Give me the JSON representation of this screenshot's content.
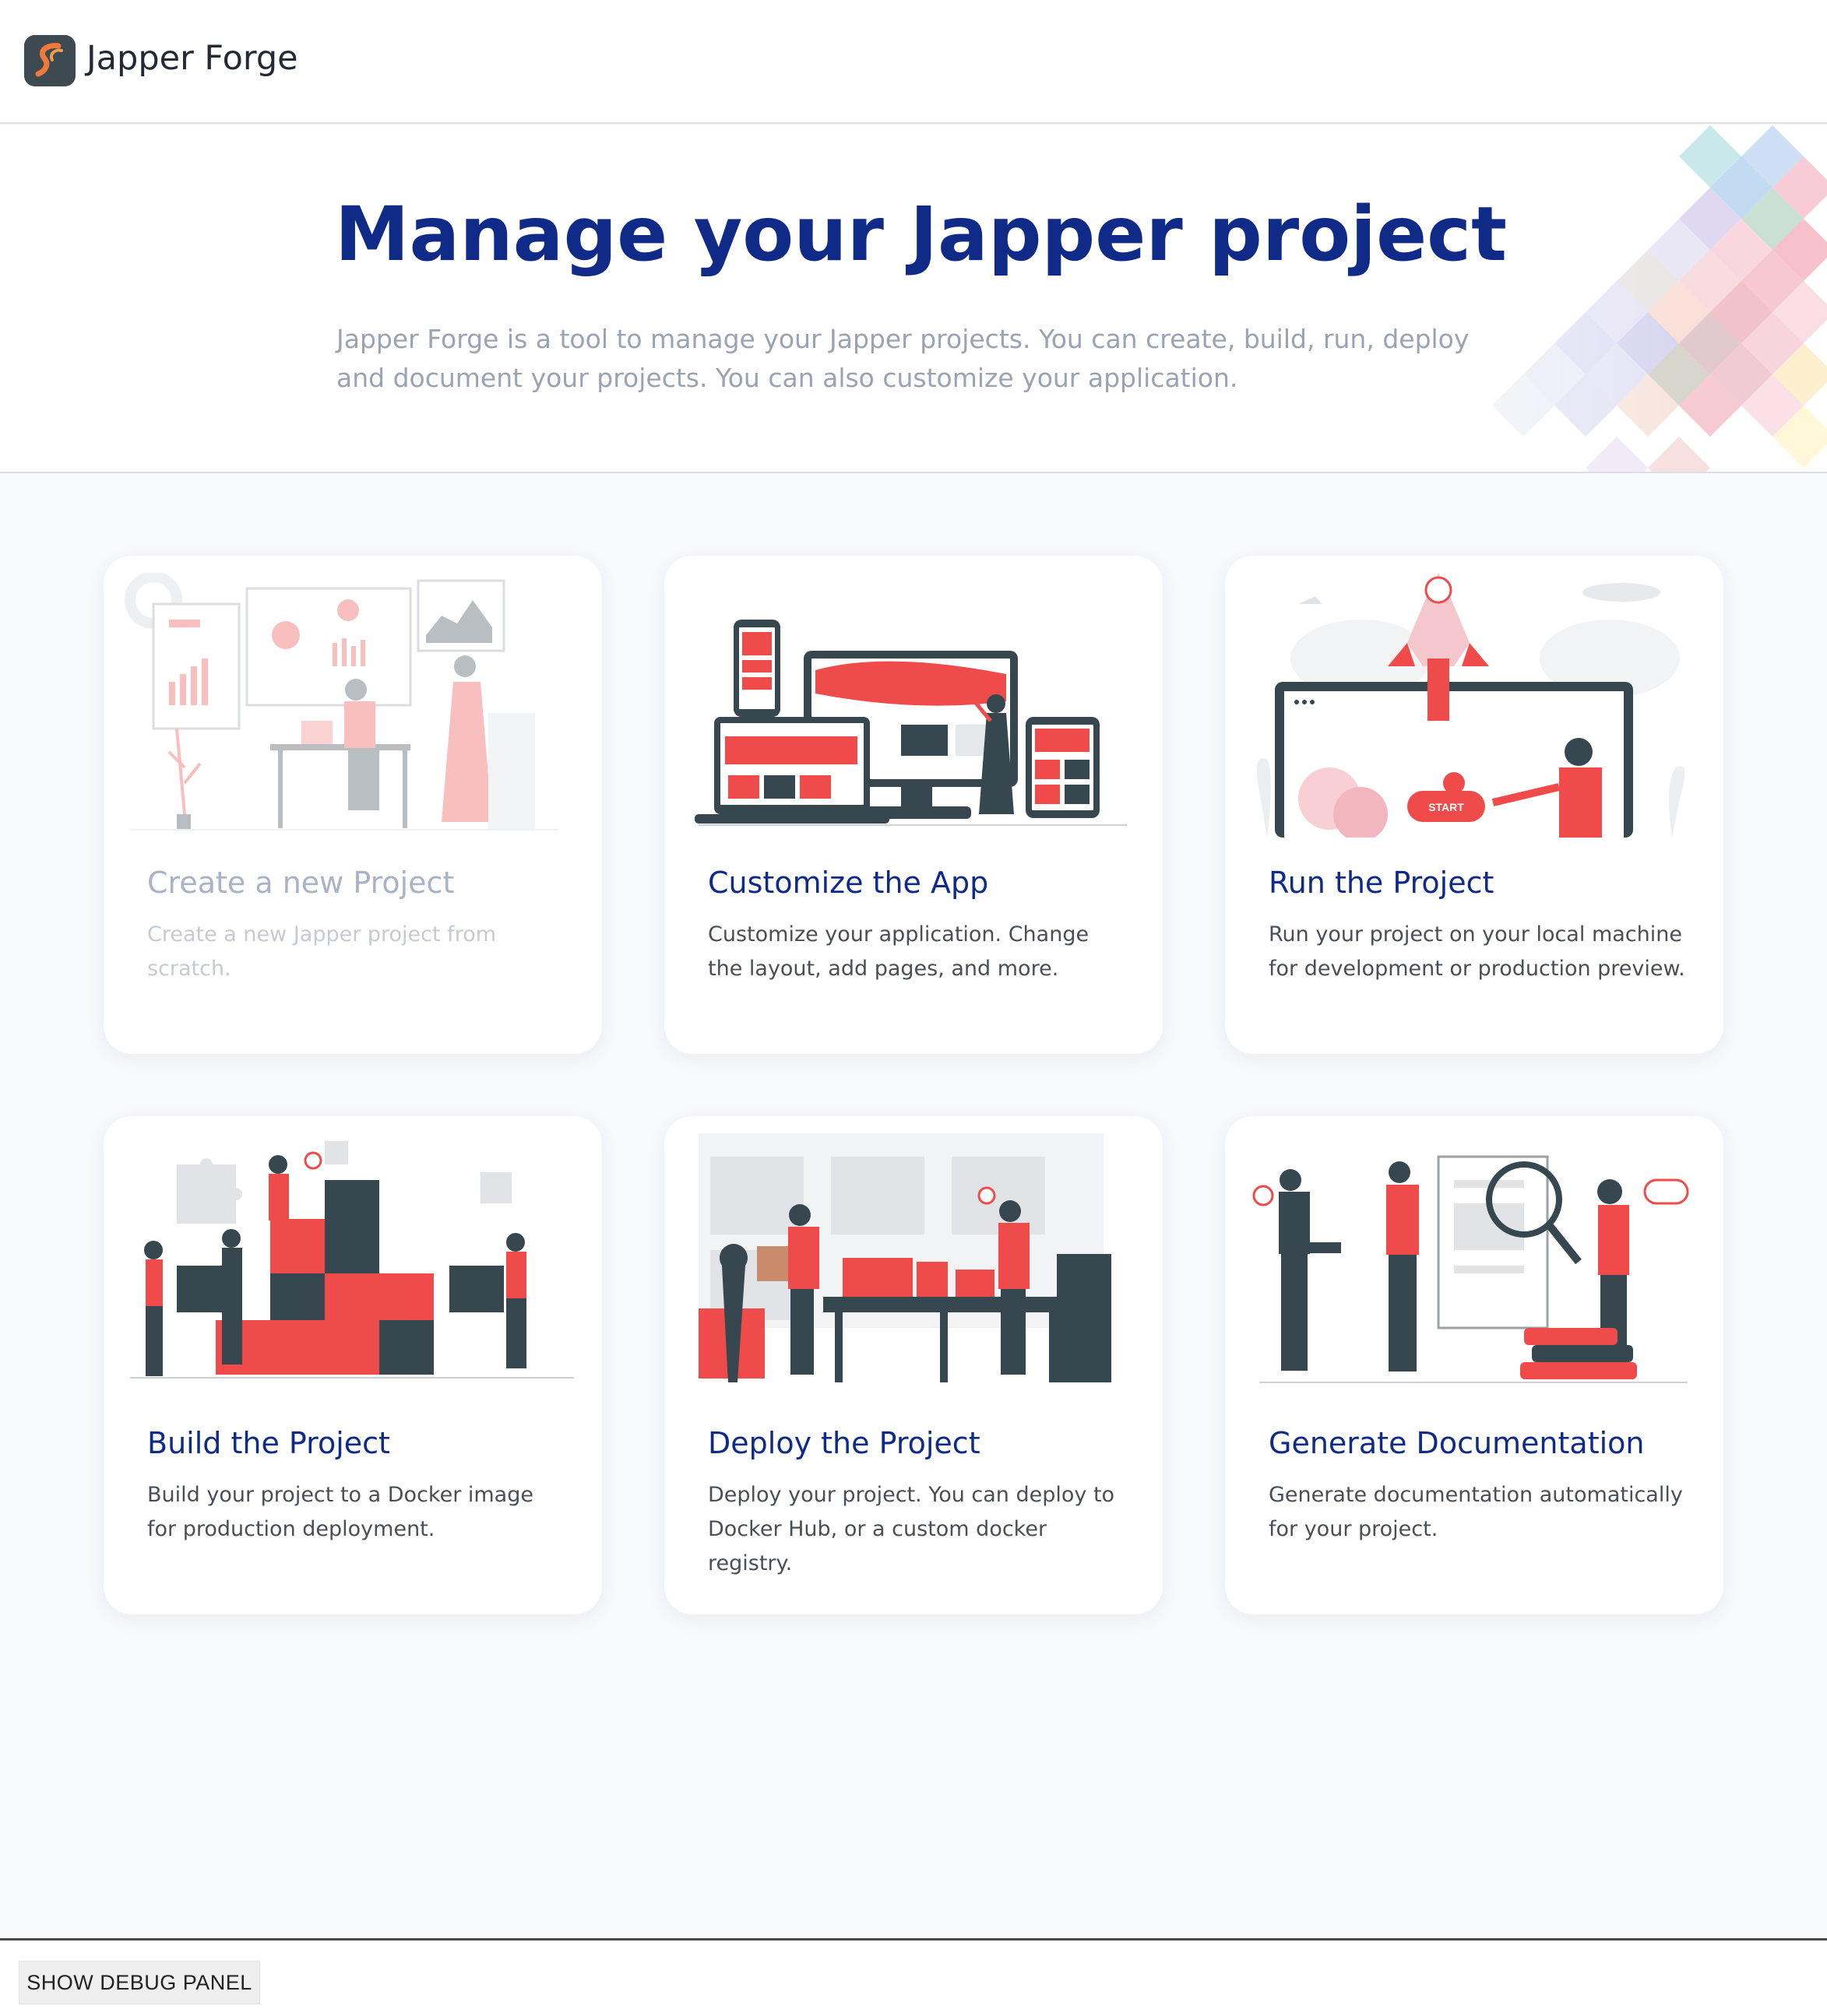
{
  "app": {
    "name": "Japper Forge",
    "logo_icon": "japper-forge-logo-icon"
  },
  "hero": {
    "title": "Manage your Japper project",
    "description": "Japper Forge is a tool to manage your Japper projects. You can create, build, run, deploy and document your projects. You can also customize your application."
  },
  "cards": [
    {
      "title": "Create a new Project",
      "description": "Create a new Japper project from scratch.",
      "illustration": "dashboard-analytics-illustration",
      "disabled": true
    },
    {
      "title": "Customize the App",
      "description": "Customize your application. Change the layout, add pages, and more.",
      "illustration": "responsive-devices-illustration",
      "disabled": false
    },
    {
      "title": "Run the Project",
      "description": "Run your project on your local machine for development or production preview.",
      "illustration": "rocket-launch-illustration",
      "disabled": false
    },
    {
      "title": "Build the Project",
      "description": "Build your project to a Docker image for production deployment.",
      "illustration": "puzzle-team-illustration",
      "disabled": false
    },
    {
      "title": "Deploy the Project",
      "description": "Deploy your project. You can deploy to Docker Hub, or a custom docker registry.",
      "illustration": "warehouse-delivery-illustration",
      "disabled": false
    },
    {
      "title": "Generate Documentation",
      "description": "Generate documentation automatically for your project.",
      "illustration": "documentation-research-illustration",
      "disabled": false
    }
  ],
  "debug": {
    "button_label": "SHOW DEBUG PANEL"
  },
  "colors": {
    "title_blue": "#0f2b87",
    "accent_red": "#ef4b4b",
    "dark_slate": "#36474f",
    "muted_text": "#9aa3b2"
  }
}
